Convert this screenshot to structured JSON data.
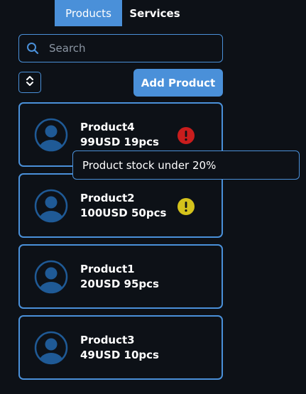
{
  "tabs": [
    {
      "label": "Products",
      "active": true
    },
    {
      "label": "Services",
      "active": false
    }
  ],
  "search": {
    "placeholder": "Search",
    "value": ""
  },
  "toolbar": {
    "add_label": "Add Product",
    "sort_icon": "sort-up-down-icon"
  },
  "products": [
    {
      "name": "Product4",
      "info": "99USD 19pcs",
      "status": "critical",
      "status_color": "#c91d1d"
    },
    {
      "name": "Product2",
      "info": "100USD 50pcs",
      "status": "warning",
      "status_color": "#d4c21c"
    },
    {
      "name": "Product1",
      "info": "20USD 95pcs",
      "status": "none"
    },
    {
      "name": "Product3",
      "info": "49USD 10pcs",
      "status": "none"
    }
  ],
  "tooltip": {
    "text": "Product stock under 20%"
  },
  "colors": {
    "accent": "#4a90d9",
    "background": "#0d1117",
    "avatar": "#1f5a96",
    "critical": "#c91d1d",
    "warning": "#d4c21c"
  }
}
